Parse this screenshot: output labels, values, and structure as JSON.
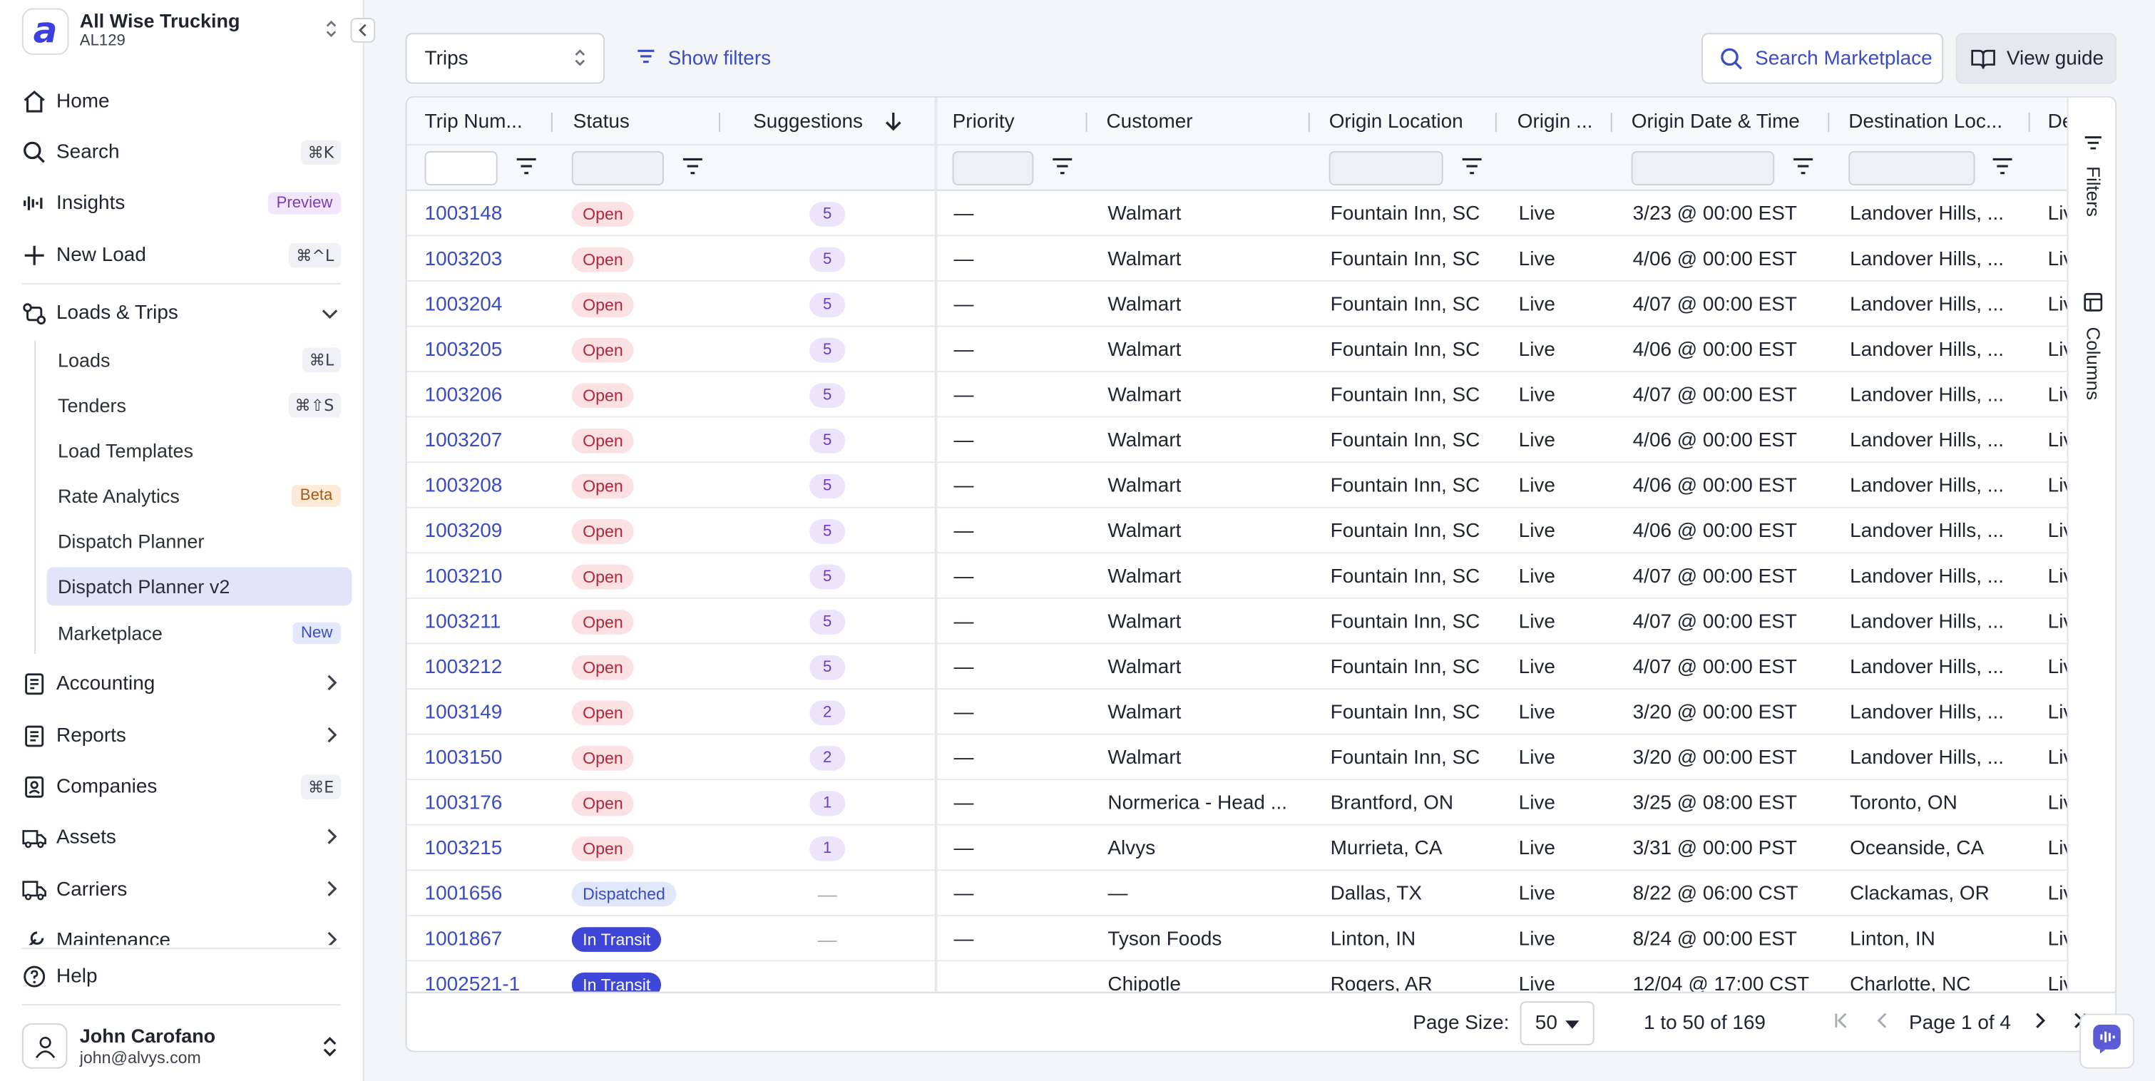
{
  "org": {
    "name": "All Wise Trucking",
    "code": "AL129"
  },
  "nav": {
    "home": "Home",
    "search": {
      "label": "Search",
      "kbd": "⌘K"
    },
    "insights": {
      "label": "Insights",
      "badge": "Preview"
    },
    "new_load": {
      "label": "New Load",
      "kbd": "⌘^L"
    },
    "loads_trips": "Loads & Trips",
    "sub": {
      "loads": {
        "label": "Loads",
        "kbd": "⌘L"
      },
      "tenders": {
        "label": "Tenders",
        "kbd": "⌘⇧S"
      },
      "load_templates": "Load Templates",
      "rate_analytics": {
        "label": "Rate Analytics",
        "badge": "Beta"
      },
      "dispatch_planner": "Dispatch Planner",
      "dispatch_planner_v2": "Dispatch Planner v2",
      "marketplace": {
        "label": "Marketplace",
        "badge": "New"
      }
    },
    "accounting": "Accounting",
    "reports": "Reports",
    "companies": {
      "label": "Companies",
      "kbd": "⌘E"
    },
    "assets": "Assets",
    "carriers": "Carriers",
    "maintenance": "Maintenance",
    "help": "Help"
  },
  "user": {
    "name": "John Carofano",
    "email": "john@alvys.com"
  },
  "toolbar": {
    "view_select": "Trips",
    "show_filters": "Show filters",
    "search_marketplace": "Search Marketplace",
    "view_guide": "View guide"
  },
  "columns": [
    "Trip Num...",
    "Status",
    "Suggestions",
    "Priority",
    "Customer",
    "Origin Location",
    "Origin ...",
    "Origin Date & Time",
    "Destination Loc...",
    "De"
  ],
  "rows": [
    {
      "trip": "1003148",
      "status": "Open",
      "sugg": "5",
      "priority": "—",
      "customer": "Walmart",
      "origin": "Fountain Inn, SC",
      "otype": "Live",
      "odate": "3/23 @ 00:00 EST",
      "dest": "Landover Hills, ...",
      "dtype": "Live"
    },
    {
      "trip": "1003203",
      "status": "Open",
      "sugg": "5",
      "priority": "—",
      "customer": "Walmart",
      "origin": "Fountain Inn, SC",
      "otype": "Live",
      "odate": "4/06 @ 00:00 EST",
      "dest": "Landover Hills, ...",
      "dtype": "Live"
    },
    {
      "trip": "1003204",
      "status": "Open",
      "sugg": "5",
      "priority": "—",
      "customer": "Walmart",
      "origin": "Fountain Inn, SC",
      "otype": "Live",
      "odate": "4/07 @ 00:00 EST",
      "dest": "Landover Hills, ...",
      "dtype": "Live"
    },
    {
      "trip": "1003205",
      "status": "Open",
      "sugg": "5",
      "priority": "—",
      "customer": "Walmart",
      "origin": "Fountain Inn, SC",
      "otype": "Live",
      "odate": "4/06 @ 00:00 EST",
      "dest": "Landover Hills, ...",
      "dtype": "Live"
    },
    {
      "trip": "1003206",
      "status": "Open",
      "sugg": "5",
      "priority": "—",
      "customer": "Walmart",
      "origin": "Fountain Inn, SC",
      "otype": "Live",
      "odate": "4/07 @ 00:00 EST",
      "dest": "Landover Hills, ...",
      "dtype": "Live"
    },
    {
      "trip": "1003207",
      "status": "Open",
      "sugg": "5",
      "priority": "—",
      "customer": "Walmart",
      "origin": "Fountain Inn, SC",
      "otype": "Live",
      "odate": "4/06 @ 00:00 EST",
      "dest": "Landover Hills, ...",
      "dtype": "Live"
    },
    {
      "trip": "1003208",
      "status": "Open",
      "sugg": "5",
      "priority": "—",
      "customer": "Walmart",
      "origin": "Fountain Inn, SC",
      "otype": "Live",
      "odate": "4/06 @ 00:00 EST",
      "dest": "Landover Hills, ...",
      "dtype": "Live"
    },
    {
      "trip": "1003209",
      "status": "Open",
      "sugg": "5",
      "priority": "—",
      "customer": "Walmart",
      "origin": "Fountain Inn, SC",
      "otype": "Live",
      "odate": "4/06 @ 00:00 EST",
      "dest": "Landover Hills, ...",
      "dtype": "Live"
    },
    {
      "trip": "1003210",
      "status": "Open",
      "sugg": "5",
      "priority": "—",
      "customer": "Walmart",
      "origin": "Fountain Inn, SC",
      "otype": "Live",
      "odate": "4/07 @ 00:00 EST",
      "dest": "Landover Hills, ...",
      "dtype": "Live"
    },
    {
      "trip": "1003211",
      "status": "Open",
      "sugg": "5",
      "priority": "—",
      "customer": "Walmart",
      "origin": "Fountain Inn, SC",
      "otype": "Live",
      "odate": "4/07 @ 00:00 EST",
      "dest": "Landover Hills, ...",
      "dtype": "Live"
    },
    {
      "trip": "1003212",
      "status": "Open",
      "sugg": "5",
      "priority": "—",
      "customer": "Walmart",
      "origin": "Fountain Inn, SC",
      "otype": "Live",
      "odate": "4/07 @ 00:00 EST",
      "dest": "Landover Hills, ...",
      "dtype": "Live"
    },
    {
      "trip": "1003149",
      "status": "Open",
      "sugg": "2",
      "priority": "—",
      "customer": "Walmart",
      "origin": "Fountain Inn, SC",
      "otype": "Live",
      "odate": "3/20 @ 00:00 EST",
      "dest": "Landover Hills, ...",
      "dtype": "Live"
    },
    {
      "trip": "1003150",
      "status": "Open",
      "sugg": "2",
      "priority": "—",
      "customer": "Walmart",
      "origin": "Fountain Inn, SC",
      "otype": "Live",
      "odate": "3/20 @ 00:00 EST",
      "dest": "Landover Hills, ...",
      "dtype": "Live"
    },
    {
      "trip": "1003176",
      "status": "Open",
      "sugg": "1",
      "priority": "—",
      "customer": "Normerica - Head ...",
      "origin": "Brantford, ON",
      "otype": "Live",
      "odate": "3/25 @ 08:00 EST",
      "dest": "Toronto, ON",
      "dtype": "Live"
    },
    {
      "trip": "1003215",
      "status": "Open",
      "sugg": "1",
      "priority": "—",
      "customer": "Alvys",
      "origin": "Murrieta, CA",
      "otype": "Live",
      "odate": "3/31 @ 00:00 PST",
      "dest": "Oceanside, CA",
      "dtype": "Live"
    },
    {
      "trip": "1001656",
      "status": "Dispatched",
      "sugg": "—",
      "priority": "—",
      "customer": "—",
      "origin": "Dallas, TX",
      "otype": "Live",
      "odate": "8/22 @ 06:00 CST",
      "dest": "Clackamas, OR",
      "dtype": "Live"
    },
    {
      "trip": "1001867",
      "status": "In Transit",
      "sugg": "—",
      "priority": "—",
      "customer": "Tyson Foods",
      "origin": "Linton, IN",
      "otype": "Live",
      "odate": "8/24 @ 00:00 EST",
      "dest": "Linton, IN",
      "dtype": "Live"
    },
    {
      "trip": "1002521-1",
      "status": "In Transit",
      "sugg": "",
      "priority": "",
      "customer": "Chipotle",
      "origin": "Rogers, AR",
      "otype": "Live",
      "odate": "12/04 @ 17:00 CST",
      "dest": "Charlotte, NC",
      "dtype": "Live"
    }
  ],
  "side_panel": {
    "filters": "Filters",
    "columns": "Columns"
  },
  "pagination": {
    "page_size_label": "Page Size:",
    "page_size": "50",
    "range": "1 to 50 of 169",
    "page": "Page 1 of 4"
  },
  "colors": {
    "accent": "#3a4cc4",
    "open": "#b0263a",
    "in_transit": "#3d46d6"
  }
}
